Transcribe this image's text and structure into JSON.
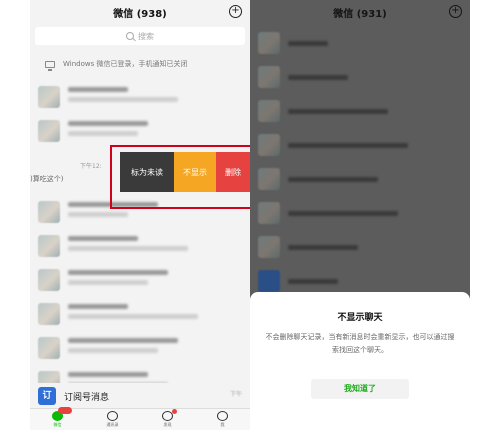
{
  "left": {
    "header_title": "微信 (938)",
    "search_placeholder": "搜索",
    "windows_notice": "Windows 微信已登录，手机通知已关闭",
    "time_label": "下午12:",
    "side_label": ")算吃这个)",
    "swipe_actions": {
      "mark_unread": "标为未读",
      "hide": "不显示",
      "delete": "删除"
    },
    "subscription": {
      "label": "订阅号消息",
      "icon_char": "订"
    },
    "tabs": [
      {
        "label": "微信",
        "icon": "chat-icon"
      },
      {
        "label": "通讯录",
        "icon": "contacts-icon"
      },
      {
        "label": "发现",
        "icon": "discover-icon"
      },
      {
        "label": "我",
        "icon": "me-icon"
      }
    ]
  },
  "right": {
    "header_title": "微信 (931)",
    "dialog": {
      "title": "不显示聊天",
      "body": "不会删除聊天记录，当有新消息时会重新显示，也可以通过搜索找回这个聊天。",
      "button": "我知道了"
    }
  },
  "colors": {
    "wechat_green": "#1aad19",
    "delete_red": "#e64340",
    "hide_orange": "#f5a623",
    "mark_gray": "#3a3a3a",
    "highlight_frame": "#d0021b"
  }
}
